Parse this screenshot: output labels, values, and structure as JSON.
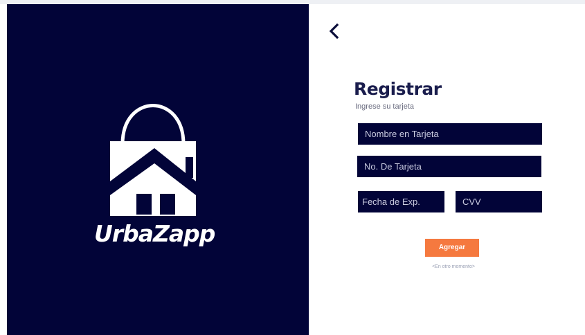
{
  "brand": {
    "name": "UrbaZapp",
    "panel_color": "#020438"
  },
  "form": {
    "title": "Registrar",
    "subtitle": "Ingrese su tarjeta",
    "fields": {
      "card_name": {
        "placeholder": "Nombre en Tarjeta"
      },
      "card_number": {
        "placeholder": "No. De Tarjeta"
      },
      "expiry": {
        "placeholder": "Fecha de Exp."
      },
      "cvv": {
        "placeholder": "CVV"
      }
    },
    "submit_label": "Agregar",
    "skip_label": "<En otro momento>",
    "accent_color": "#f5793f"
  },
  "icons": {
    "back": "chevron-left-icon",
    "logo": "house-shopping-bag-icon"
  }
}
